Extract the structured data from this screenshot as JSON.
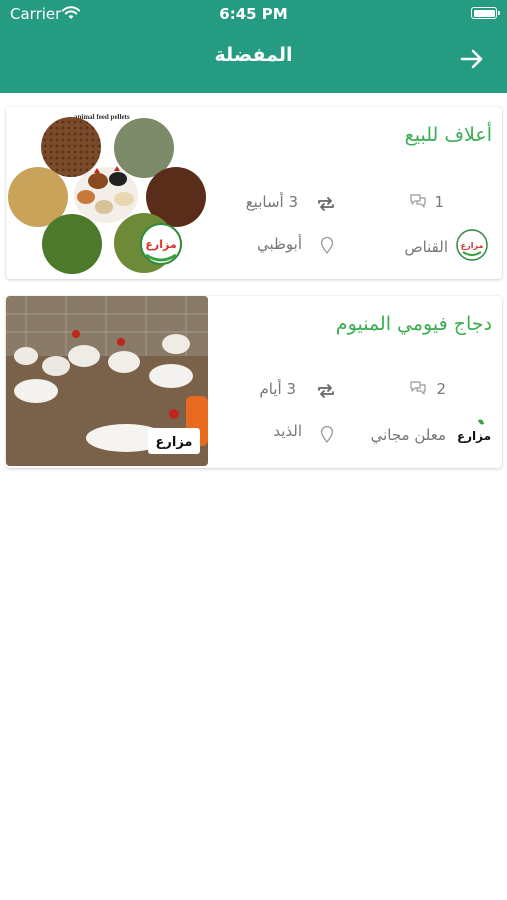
{
  "status_bar": {
    "carrier": "Carrier",
    "time": "6:45 PM"
  },
  "header": {
    "title": "المفضلة"
  },
  "listings": [
    {
      "title": "أعلاف للبيع",
      "comments": "1",
      "age": "3 أسابيع",
      "seller": "القناص",
      "location": "أبوظبي",
      "image_caption": "animal feed pellets"
    },
    {
      "title": "دجاج فيومي المنيوم",
      "comments": "2",
      "age": "3 أيام",
      "seller": "معلن مجاني",
      "location": "الذيد"
    }
  ],
  "brand_logo": "مزارع",
  "colors": {
    "header": "#259c82",
    "title_green": "#3cae52"
  }
}
